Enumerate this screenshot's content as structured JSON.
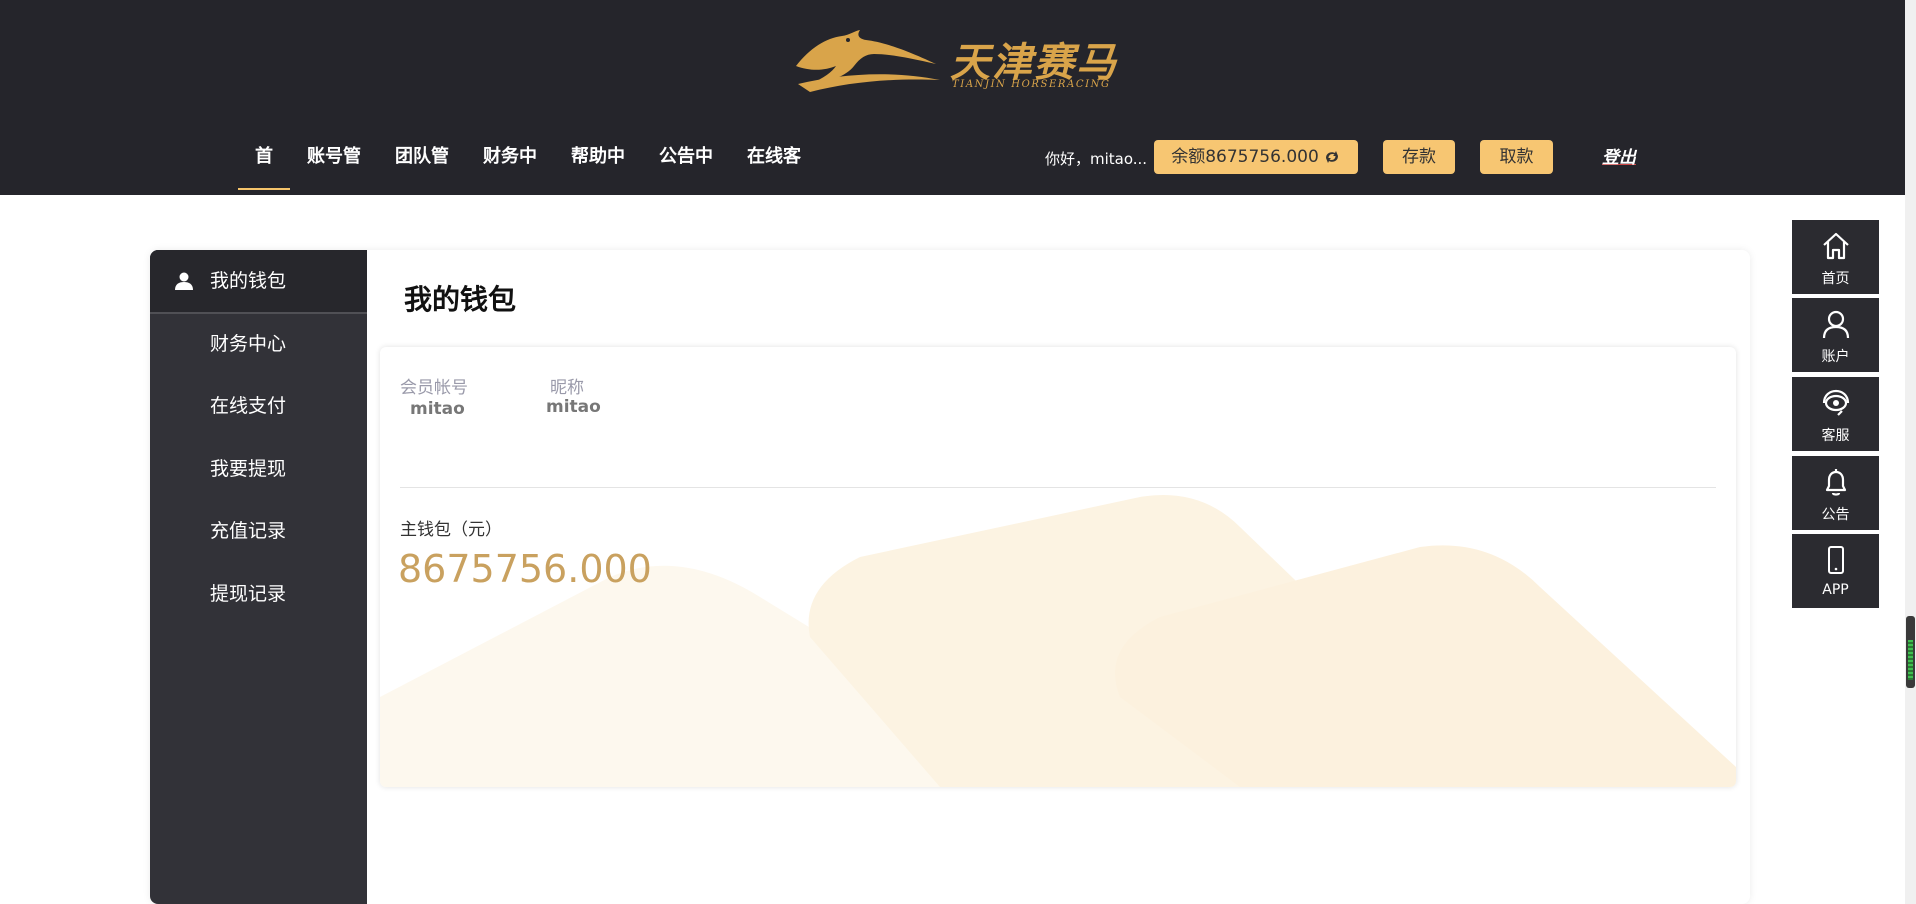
{
  "header": {
    "logo_text": "天津赛马",
    "logo_sub": "TIANJIN HORSERACING",
    "nav": [
      {
        "label": "首"
      },
      {
        "label": "账号管"
      },
      {
        "label": "团队管"
      },
      {
        "label": "财务中"
      },
      {
        "label": "帮助中"
      },
      {
        "label": "公告中"
      },
      {
        "label": "在线客"
      }
    ],
    "greeting": "你好，mitao...",
    "balance_label": "余额8675756.000",
    "deposit_label": "存款",
    "withdraw_label": "取款",
    "logout_label": "登出"
  },
  "sidebar": {
    "items": [
      {
        "label": "我的钱包"
      },
      {
        "label": "财务中心"
      },
      {
        "label": "在线支付"
      },
      {
        "label": "我要提现"
      },
      {
        "label": "充值记录"
      },
      {
        "label": "提现记录"
      }
    ]
  },
  "main": {
    "title": "我的钱包",
    "account_label": "会员帐号",
    "account_value": "mitao",
    "nickname_label": "昵称",
    "nickname_value": "mitao",
    "wallet_label": "主钱包（元）",
    "wallet_amount": "8675756.000"
  },
  "float_menu": [
    {
      "label": "首页",
      "icon": "home-icon"
    },
    {
      "label": "账户",
      "icon": "user-icon"
    },
    {
      "label": "客服",
      "icon": "headset-icon"
    },
    {
      "label": "公告",
      "icon": "bell-icon"
    },
    {
      "label": "APP",
      "icon": "phone-icon"
    }
  ],
  "colors": {
    "header_bg": "#25252b",
    "accent_gold": "#f7c672",
    "logo_gold": "#d9a44a",
    "amount_gold": "#c9a15f",
    "sidebar_bg": "#323238"
  }
}
